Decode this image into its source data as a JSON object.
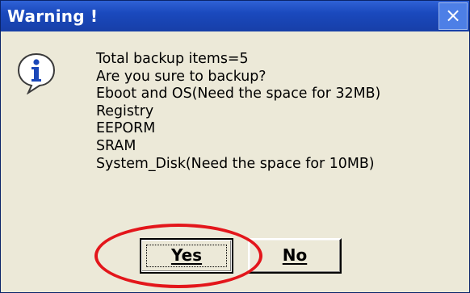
{
  "dialog": {
    "title": "Warning !",
    "close_glyph": "×",
    "icon": "info-icon",
    "message_lines": [
      "Total backup items=5",
      "Are you sure to backup?",
      "Eboot and OS(Need the space for 32MB)",
      "Registry",
      "EEPORM",
      "SRAM",
      "System_Disk(Need the space for 10MB)"
    ],
    "buttons": {
      "yes_label": "Yes",
      "no_label": "No"
    }
  },
  "colors": {
    "titlebar": "#1a49bd",
    "dialog_background": "#ece9d8",
    "highlight_ring": "#e3161b",
    "info_icon_fill": "#ffffff",
    "info_icon_letter": "#1a47b8"
  }
}
